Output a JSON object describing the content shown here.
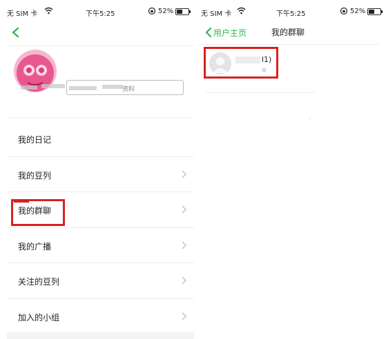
{
  "left": {
    "status_bar": {
      "carrier": "无 SIM 卡",
      "time": "下午5:25",
      "battery": "52%",
      "battery_level": 0.52
    },
    "profile": {
      "field_text": "资料"
    },
    "menu": [
      {
        "label": "我的日记",
        "has_chevron": false
      },
      {
        "label": "我的豆列",
        "has_chevron": true
      },
      {
        "label": "我的群聊",
        "has_chevron": true
      },
      {
        "label": "我的广播",
        "has_chevron": true
      },
      {
        "label": "关注的豆列",
        "has_chevron": true
      },
      {
        "label": "加入的小组",
        "has_chevron": true
      }
    ]
  },
  "right": {
    "status_bar": {
      "carrier": "无 SIM 卡",
      "time": "下午5:25",
      "battery": "52%",
      "battery_level": 0.52
    },
    "nav": {
      "back_label": "用户主页",
      "title": "我的群聊"
    },
    "group": {
      "name_suffix": "l1)",
      "sub": "早"
    }
  },
  "colors": {
    "accent": "#2db84b",
    "highlight": "#d92020"
  }
}
